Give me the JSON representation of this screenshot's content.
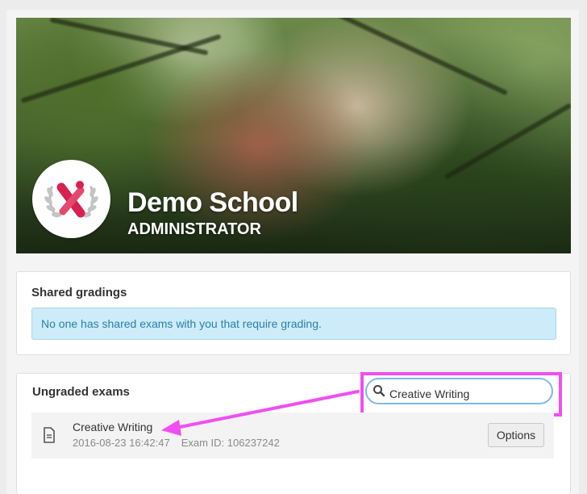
{
  "header": {
    "school_name": "Demo School",
    "role": "ADMINISTRATOR"
  },
  "shared_gradings": {
    "title": "Shared gradings",
    "alert_text": "No one has shared exams with you that require grading."
  },
  "ungraded_exams": {
    "title": "Ungraded exams",
    "search_value": "Creative Writing",
    "exams": [
      {
        "title": "Creative Writing",
        "timestamp": "2016-08-23 16:42:47",
        "exam_id": "Exam ID: 106237242",
        "options_label": "Options"
      }
    ]
  },
  "icons": {
    "logo": "school-logo-x-laurel",
    "search": "search-icon",
    "document": "document-icon"
  },
  "colors": {
    "annotation": "#f04ff0",
    "alert_bg": "#cdebf8",
    "alert_text": "#2a7fa8",
    "logo_red": "#d8214f"
  }
}
